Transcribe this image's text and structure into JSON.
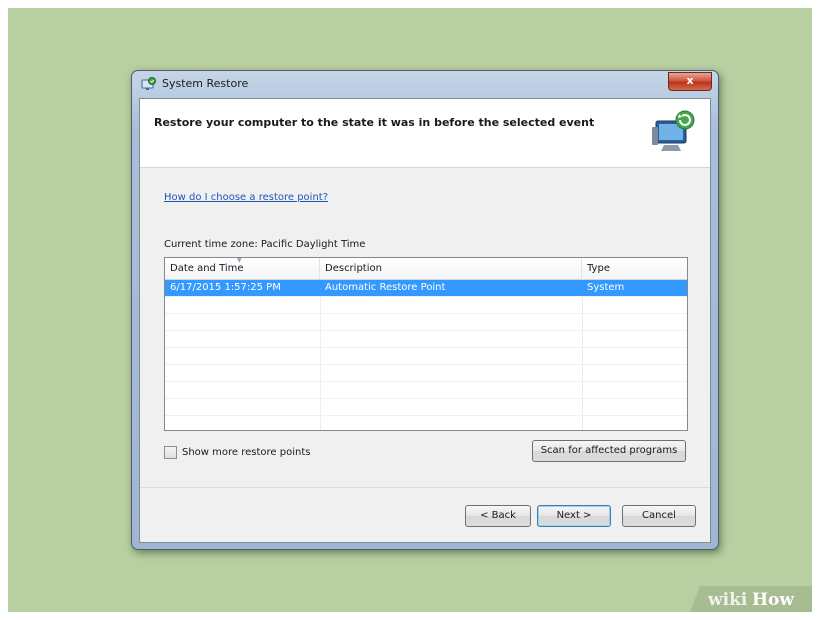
{
  "window": {
    "title": "System Restore",
    "close_label": "x",
    "icon": "system-restore-icon"
  },
  "header": {
    "heading": "Restore your computer to the state it was in before the selected event",
    "icon": "monitor-restore-icon"
  },
  "help_link": "How do I choose a restore point?",
  "timezone_label": "Current time zone: Pacific Daylight Time",
  "table": {
    "columns": [
      "Date and Time",
      "Description",
      "Type"
    ],
    "rows": [
      {
        "date": "6/17/2015 1:57:25 PM",
        "description": "Automatic Restore Point",
        "type": "System",
        "selected": true
      }
    ]
  },
  "show_more_label": "Show more restore points",
  "show_more_checked": false,
  "buttons": {
    "scan": "Scan for affected programs",
    "back": "< Back",
    "next": "Next >",
    "cancel": "Cancel"
  },
  "watermark": "wikiHow",
  "colors": {
    "background": "#b8cfa1",
    "selection": "#3399ff",
    "link": "#1f55b5"
  }
}
